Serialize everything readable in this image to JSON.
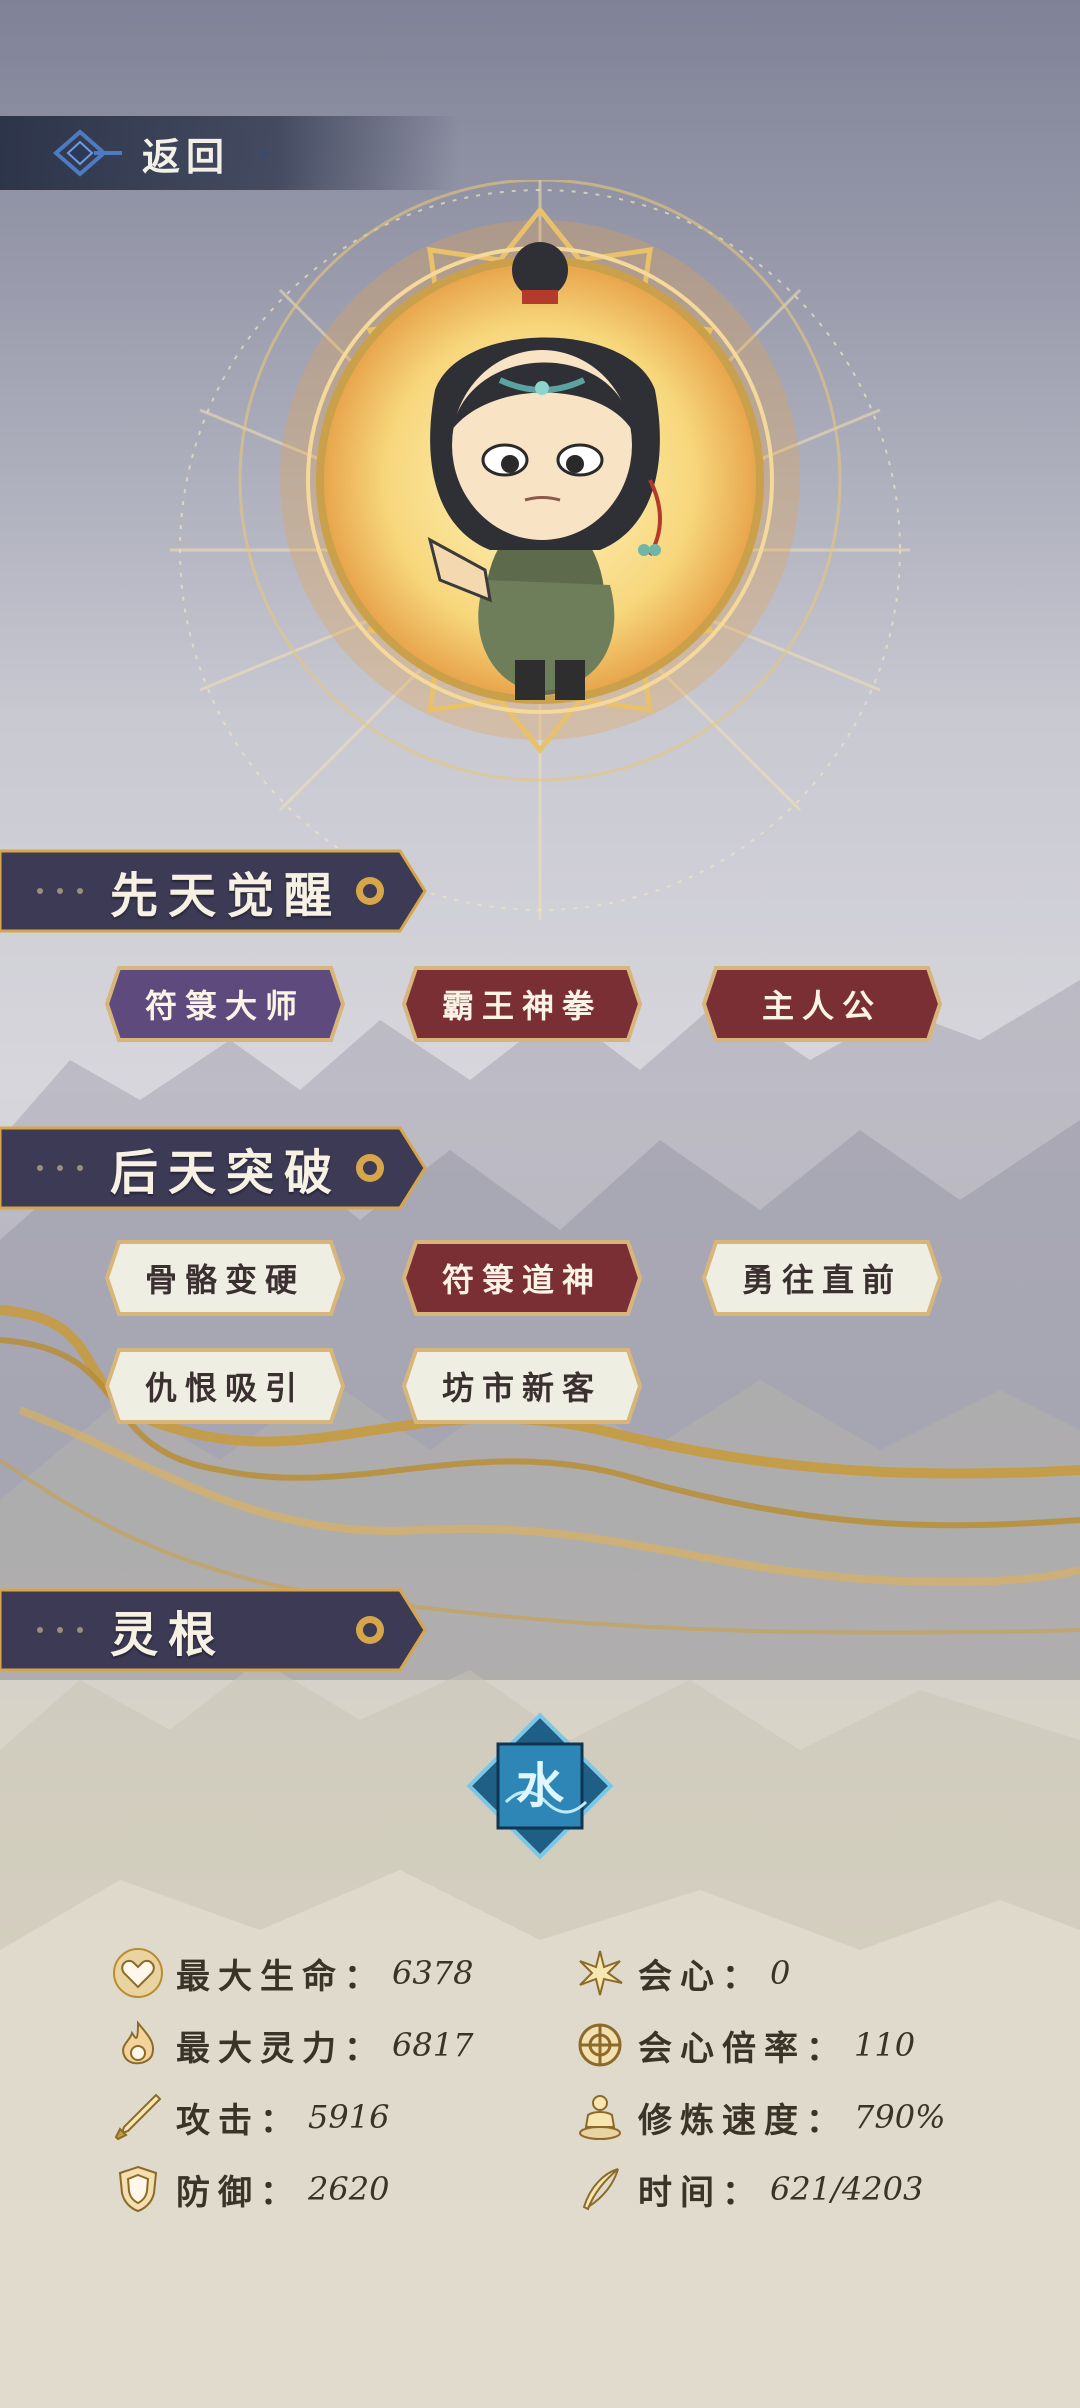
{
  "header": {
    "back_label": "返回"
  },
  "sections": {
    "innate": {
      "title": "先天觉醒"
    },
    "acquired": {
      "title": "后天突破"
    },
    "spirit_root": {
      "title": "灵根"
    }
  },
  "innate_tags": [
    {
      "label": "符箓大师",
      "style": "purple"
    },
    {
      "label": "霸王神拳",
      "style": "red"
    },
    {
      "label": "主人公",
      "style": "red"
    }
  ],
  "acquired_tags": [
    {
      "label": "骨骼变硬",
      "style": "light"
    },
    {
      "label": "符箓道神",
      "style": "red"
    },
    {
      "label": "勇往直前",
      "style": "light"
    },
    {
      "label": "仇恨吸引",
      "style": "light"
    },
    {
      "label": "坊市新客",
      "style": "light"
    }
  ],
  "spirit_root": {
    "element": "水"
  },
  "stats": [
    {
      "icon": "heart-icon",
      "label": "最大生命：",
      "value": "6378"
    },
    {
      "icon": "critical-icon",
      "label": "会心：",
      "value": "0"
    },
    {
      "icon": "spirit-flame-icon",
      "label": "最大灵力：",
      "value": "6817"
    },
    {
      "icon": "critical-rate-icon",
      "label": "会心倍率：",
      "value": "110"
    },
    {
      "icon": "sword-icon",
      "label": "攻击：",
      "value": "5916"
    },
    {
      "icon": "meditation-icon",
      "label": "修炼速度：",
      "value": "790%"
    },
    {
      "icon": "shield-icon",
      "label": "防御：",
      "value": "2620"
    },
    {
      "icon": "feather-icon",
      "label": "时间：",
      "value": "621/4203"
    }
  ],
  "colors": {
    "purple_tag": "#5e4a7c",
    "red_tag": "#7a2f35",
    "light_tag": "#eeeee2",
    "gold": "#d8a64a",
    "header_dark": "#3c3a55"
  }
}
